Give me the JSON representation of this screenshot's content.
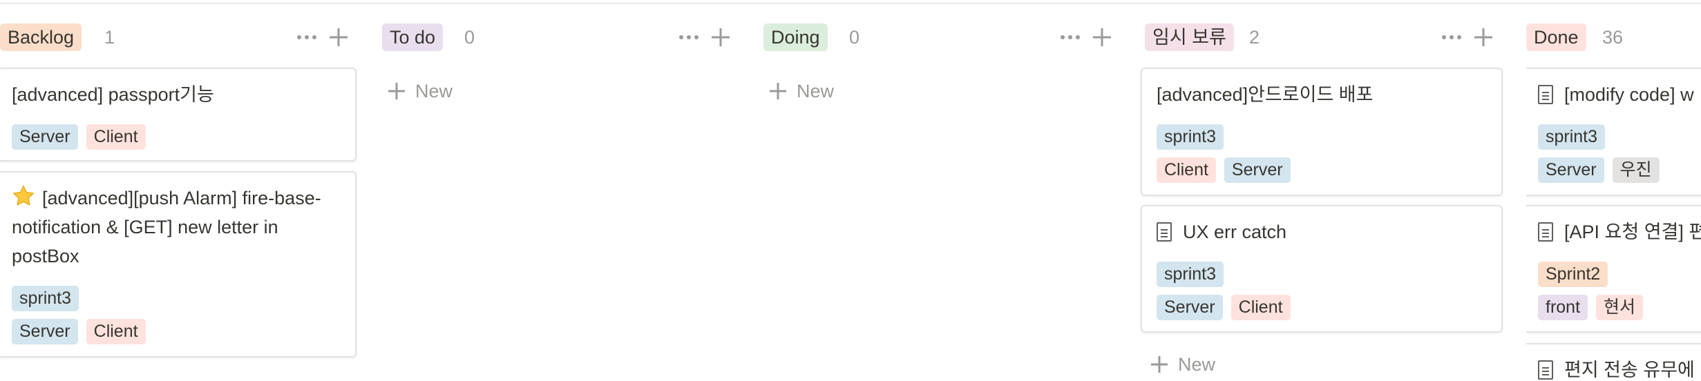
{
  "colors": {
    "backlog_header": "#fadec9",
    "todo_header": "#e8deee",
    "doing_header": "#dbeddb",
    "hold_header": "#f5e0e9",
    "done_header": "#ffe2dd",
    "tag_blue": "#d3e5ef",
    "tag_red": "#ffe2dd",
    "tag_orange": "#fadec9",
    "tag_gray": "#e3e2e0",
    "tag_purple": "#e8deee"
  },
  "columns": [
    {
      "title": "Backlog",
      "count": "1",
      "cards": [
        {
          "title": "[advanced] passport기능",
          "icon": "none",
          "tag_rows": [
            [
              {
                "label": "Server",
                "color": "blue"
              },
              {
                "label": "Client",
                "color": "red"
              }
            ]
          ]
        },
        {
          "title": "[advanced][push Alarm] fire-base-notification & [GET] new letter in postBox",
          "icon": "star-icon",
          "tag_rows": [
            [
              {
                "label": "sprint3",
                "color": "blue"
              }
            ],
            [
              {
                "label": "Server",
                "color": "blue"
              },
              {
                "label": "Client",
                "color": "red"
              }
            ]
          ]
        }
      ]
    },
    {
      "title": "To do",
      "count": "0",
      "new_label": "New",
      "cards": []
    },
    {
      "title": "Doing",
      "count": "0",
      "new_label": "New",
      "cards": []
    },
    {
      "title": "임시 보류",
      "count": "2",
      "new_label": "New",
      "cards": [
        {
          "title": "[advanced]안드로이드 배포",
          "icon": "none",
          "tag_rows": [
            [
              {
                "label": "sprint3",
                "color": "blue"
              }
            ],
            [
              {
                "label": "Client",
                "color": "red"
              },
              {
                "label": "Server",
                "color": "blue"
              }
            ]
          ]
        },
        {
          "title": "UX err catch",
          "icon": "page-icon",
          "tag_rows": [
            [
              {
                "label": "sprint3",
                "color": "blue"
              }
            ],
            [
              {
                "label": "Server",
                "color": "blue"
              },
              {
                "label": "Client",
                "color": "red"
              }
            ]
          ]
        }
      ]
    },
    {
      "title": "Done",
      "count": "36",
      "cards": [
        {
          "title": "[modify code] w",
          "icon": "page-icon",
          "tag_rows": [
            [
              {
                "label": "sprint3",
                "color": "blue"
              }
            ],
            [
              {
                "label": "Server",
                "color": "blue"
              },
              {
                "label": "우진",
                "color": "gray"
              }
            ]
          ]
        },
        {
          "title": "[API 요청 연결] 편",
          "icon": "page-icon",
          "tag_rows": [
            [
              {
                "label": "Sprint2",
                "color": "orange"
              }
            ],
            [
              {
                "label": "front",
                "color": "purple"
              },
              {
                "label": "현서",
                "color": "red"
              }
            ]
          ]
        },
        {
          "title": "편지 전송 유무에 대",
          "icon": "page-icon",
          "tag_rows": []
        }
      ]
    }
  ]
}
